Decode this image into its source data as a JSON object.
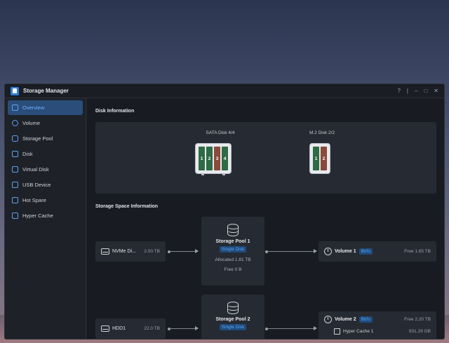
{
  "window": {
    "title": "Storage Manager",
    "controls": {
      "help": "?",
      "pin": "|",
      "minimize": "–",
      "maximize": "□",
      "close": "✕"
    }
  },
  "sidebar": {
    "items": [
      {
        "label": "Overview",
        "icon": "monitor-icon",
        "active": true
      },
      {
        "label": "Volume",
        "icon": "clock-icon"
      },
      {
        "label": "Storage Pool",
        "icon": "database-icon"
      },
      {
        "label": "Disk",
        "icon": "hdd-icon"
      },
      {
        "label": "Virtual Disk",
        "icon": "virtual-disk-icon"
      },
      {
        "label": "USB Device",
        "icon": "usb-icon"
      },
      {
        "label": "Hot Spare",
        "icon": "hot-spare-icon"
      },
      {
        "label": "Hyper Cache",
        "icon": "cache-icon"
      }
    ]
  },
  "disk_info": {
    "title": "Disk Information",
    "sata": {
      "label": "SATA Disk 4/4",
      "bays": [
        "1",
        "2",
        "3",
        "4"
      ]
    },
    "m2": {
      "label": "M.2 Disk 2/2",
      "bays": [
        "1",
        "2"
      ]
    }
  },
  "storage_space": {
    "title": "Storage Space Information",
    "disks": [
      {
        "name": "NVMe Di...",
        "size": "2.00 TB"
      },
      {
        "name": "HDD1",
        "size": "22.0 TB"
      }
    ],
    "pools": [
      {
        "name": "Storage Pool 1",
        "tag": "Single Disk",
        "allocated": "Allocated 1.81 TB",
        "free": "Free 0 B"
      },
      {
        "name": "Storage Pool 2",
        "tag": "Single Disk"
      }
    ],
    "volumes": [
      {
        "name": "Volume 1",
        "fs": "Btrfs",
        "free": "Free 1.65 TB"
      },
      {
        "name": "Volume 2",
        "fs": "Btrfs",
        "free": "Free 2.20 TB",
        "cache_name": "Hyper Cache 1",
        "cache_size": "931.29 GB"
      }
    ]
  },
  "colors": {
    "accent": "#2f7fd8",
    "active_bg": "#2a4d7a",
    "disk_green": "#2f6b45",
    "disk_red": "#8b4a3a"
  }
}
